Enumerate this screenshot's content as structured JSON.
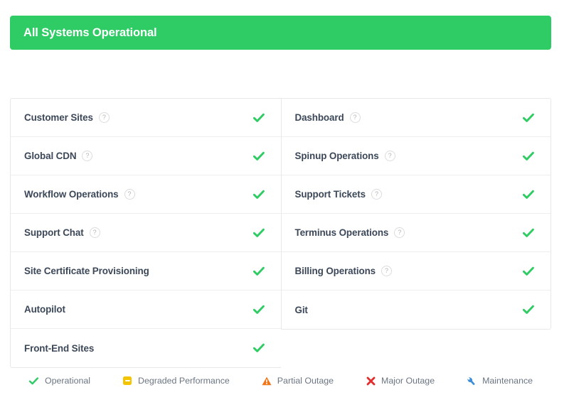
{
  "banner": {
    "title": "All Systems Operational",
    "color": "#2fcc66"
  },
  "components": {
    "left_column": [
      {
        "name": "Customer Sites",
        "has_help": true,
        "status": "operational"
      },
      {
        "name": "Global CDN",
        "has_help": true,
        "status": "operational"
      },
      {
        "name": "Workflow Operations",
        "has_help": true,
        "status": "operational"
      },
      {
        "name": "Support Chat",
        "has_help": true,
        "status": "operational"
      },
      {
        "name": "Site Certificate Provisioning",
        "has_help": false,
        "status": "operational"
      },
      {
        "name": "Autopilot",
        "has_help": false,
        "status": "operational"
      },
      {
        "name": "Front-End Sites",
        "has_help": false,
        "status": "operational"
      }
    ],
    "right_column": [
      {
        "name": "Dashboard",
        "has_help": true,
        "status": "operational"
      },
      {
        "name": "Spinup Operations",
        "has_help": true,
        "status": "operational"
      },
      {
        "name": "Support Tickets",
        "has_help": true,
        "status": "operational"
      },
      {
        "name": "Terminus Operations",
        "has_help": true,
        "status": "operational"
      },
      {
        "name": "Billing Operations",
        "has_help": true,
        "status": "operational"
      },
      {
        "name": "Git",
        "has_help": false,
        "status": "operational"
      }
    ],
    "help_badge_label": "?"
  },
  "legend": [
    {
      "label": "Operational",
      "icon": "check-icon",
      "color": "#2fcc66"
    },
    {
      "label": "Degraded Performance",
      "icon": "minus-box-icon",
      "color": "#f5c400"
    },
    {
      "label": "Partial Outage",
      "icon": "warning-triangle-icon",
      "color": "#f0761a"
    },
    {
      "label": "Major Outage",
      "icon": "cross-icon",
      "color": "#e02d2d"
    },
    {
      "label": "Maintenance",
      "icon": "wrench-icon",
      "color": "#3f8fd8"
    }
  ]
}
